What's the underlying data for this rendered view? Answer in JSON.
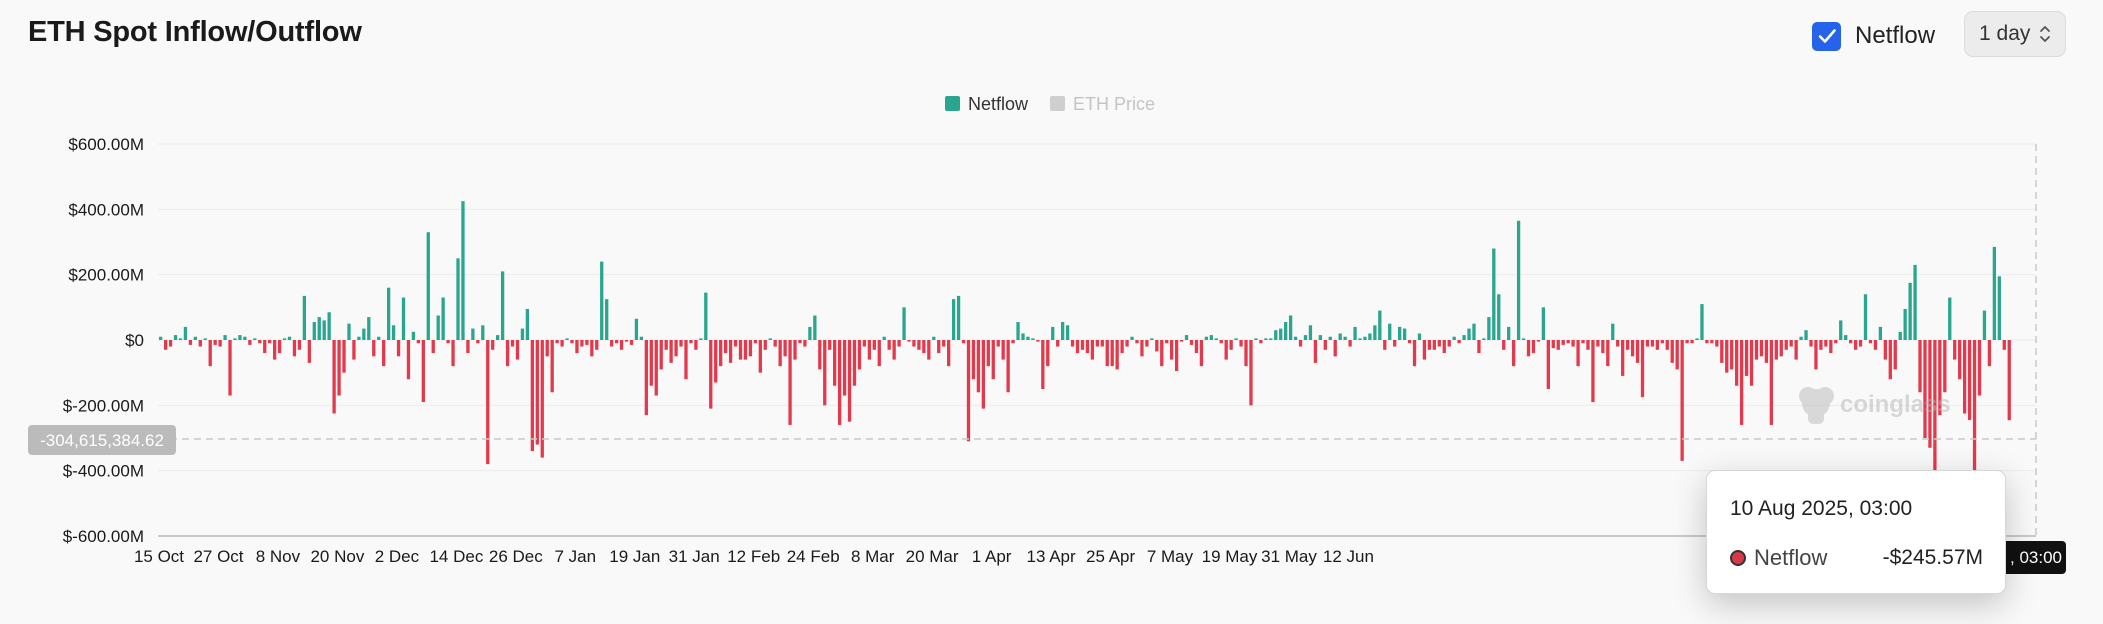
{
  "page": {
    "title": "ETH Spot Inflow/Outflow"
  },
  "controls": {
    "netflow_label": "Netflow",
    "netflow_checked": true,
    "interval_value": "1 day"
  },
  "watermark": "coinglass",
  "crosshair": {
    "y_readout": "-304,615,384.62",
    "x_readout_partial": ", 03:00"
  },
  "tooltip": {
    "date": "10 Aug 2025, 03:00",
    "series": "Netflow",
    "value": "-$245.57M"
  },
  "colors": {
    "positive": "#2aa68f",
    "negative": "#e23a4c",
    "price": "#cfcfcf",
    "grid": "#ececec"
  },
  "chart_data": {
    "type": "bar",
    "legend": [
      {
        "name": "Netflow",
        "color": "#2aa68f",
        "active": true
      },
      {
        "name": "ETH Price",
        "color": "#cfcfcf",
        "active": false
      }
    ],
    "legend_position": "top-center",
    "y_ticks": [
      "$600.00M",
      "$400.00M",
      "$200.00M",
      "$0",
      "$-200.00M",
      "$-400.00M",
      "$-600.00M"
    ],
    "y_tick_values": [
      600,
      400,
      200,
      0,
      -200,
      -400,
      -600
    ],
    "ylim": [
      -600,
      600
    ],
    "y_unit": "USD millions",
    "x_ticks": [
      "15 Oct",
      "27 Oct",
      "8 Nov",
      "20 Nov",
      "2 Dec",
      "14 Dec",
      "26 Dec",
      "7 Jan",
      "19 Jan",
      "31 Jan",
      "12 Feb",
      "24 Feb",
      "8 Mar",
      "20 Mar",
      "1 Apr",
      "13 Apr",
      "25 Apr",
      "7 May",
      "19 May",
      "31 May",
      "12 Jun"
    ],
    "x_tick_spacing_days": 12,
    "grid": true,
    "series": [
      {
        "name": "Netflow",
        "values": [
          10,
          -30,
          -20,
          15,
          5,
          40,
          -15,
          10,
          -20,
          5,
          -80,
          -15,
          -20,
          15,
          -170,
          5,
          15,
          10,
          -15,
          5,
          -10,
          -40,
          -10,
          -60,
          -40,
          5,
          10,
          -50,
          -30,
          135,
          -70,
          55,
          70,
          60,
          85,
          -225,
          -170,
          -100,
          50,
          -60,
          10,
          35,
          70,
          -50,
          10,
          -80,
          160,
          45,
          -50,
          130,
          -120,
          25,
          -10,
          -190,
          330,
          -40,
          75,
          130,
          -10,
          -80,
          250,
          425,
          -40,
          35,
          -10,
          45,
          -380,
          -30,
          15,
          210,
          -80,
          -20,
          -60,
          35,
          95,
          -340,
          -320,
          -360,
          -50,
          -160,
          -10,
          -20,
          5,
          -10,
          -40,
          -20,
          -15,
          -50,
          -30,
          240,
          125,
          -20,
          -10,
          -30,
          -5,
          -15,
          65,
          10,
          -230,
          -140,
          -170,
          -90,
          -30,
          -70,
          -50,
          -20,
          -120,
          -10,
          -30,
          5,
          145,
          -210,
          -130,
          -80,
          -40,
          -70,
          -20,
          -60,
          -60,
          -50,
          -10,
          -100,
          -30,
          5,
          -20,
          -80,
          -50,
          -260,
          -60,
          -10,
          -20,
          40,
          75,
          -90,
          -200,
          -30,
          -140,
          -260,
          -170,
          -250,
          -140,
          -90,
          -20,
          -60,
          -30,
          -80,
          10,
          -30,
          -60,
          -20,
          100,
          -5,
          -20,
          -30,
          -40,
          -60,
          10,
          -40,
          -20,
          -80,
          125,
          135,
          -10,
          -310,
          -120,
          -160,
          -210,
          -80,
          -120,
          -20,
          -60,
          -160,
          -10,
          55,
          20,
          10,
          5,
          -5,
          -150,
          -80,
          40,
          -20,
          55,
          45,
          -20,
          -40,
          -30,
          -40,
          -60,
          -20,
          -20,
          -80,
          -80,
          -90,
          -40,
          -20,
          10,
          -10,
          -50,
          -20,
          5,
          -35,
          -80,
          -10,
          -60,
          -95,
          -5,
          15,
          -15,
          -40,
          -80,
          10,
          15,
          5,
          -10,
          -60,
          -30,
          5,
          -20,
          -80,
          -200,
          5,
          -10,
          5,
          5,
          30,
          35,
          55,
          75,
          10,
          -20,
          15,
          45,
          -70,
          15,
          -30,
          10,
          -50,
          20,
          10,
          -20,
          40,
          5,
          10,
          20,
          45,
          90,
          -30,
          50,
          -20,
          40,
          35,
          -10,
          -80,
          20,
          -60,
          -30,
          -30,
          -20,
          -40,
          -20,
          10,
          -10,
          15,
          35,
          50,
          -40,
          5,
          70,
          280,
          140,
          -30,
          40,
          -80,
          365,
          5,
          -50,
          -40,
          -5,
          100,
          -150,
          -25,
          -30,
          -15,
          -10,
          -20,
          -80,
          -10,
          -30,
          -190,
          -20,
          -40,
          -80,
          50,
          -20,
          -110,
          -30,
          -50,
          -70,
          -175,
          -20,
          -20,
          -30,
          -10,
          -30,
          -70,
          -90,
          -370,
          -10,
          -10,
          5,
          110,
          -10,
          -10,
          -20,
          -70,
          -100,
          -90,
          -140,
          -260,
          -110,
          -140,
          -60,
          -50,
          -70,
          -260,
          -60,
          -50,
          -30,
          -20,
          -60,
          10,
          30,
          -20,
          -90,
          -30,
          -20,
          -40,
          -10,
          60,
          15,
          -10,
          -30,
          -20,
          140,
          -10,
          -30,
          40,
          -60,
          -120,
          -90,
          25,
          95,
          175,
          230,
          -160,
          -300,
          -330,
          -400,
          -230,
          -160,
          130,
          -60,
          -120,
          -225,
          -245,
          -400,
          -170,
          90,
          -80,
          285,
          195,
          -30,
          -245.57
        ]
      }
    ]
  }
}
